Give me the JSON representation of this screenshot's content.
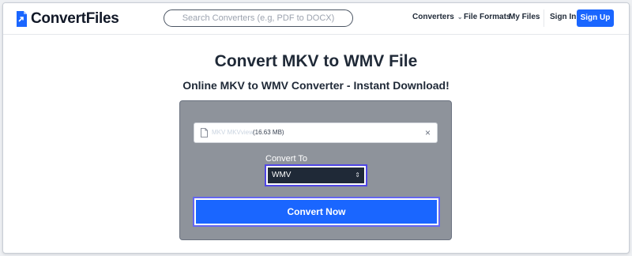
{
  "brand": {
    "name": "ConvertFiles",
    "color": "#1a66ff"
  },
  "nav": {
    "search_placeholder": "Search Converters (e.g, PDF to DOCX)",
    "converters": "Converters",
    "file_formats": "File Formats",
    "my_files": "My Files",
    "sign_in": "Sign In",
    "sign_up": "Sign Up"
  },
  "main": {
    "title": "Convert MKV to WMV File",
    "subtitle": "Online MKV to WMV Converter - Instant Download!"
  },
  "converter": {
    "file_name": "MKV MKVview",
    "file_size": "(16.63 MB)",
    "convert_to_label": "Convert To",
    "selected_format": "WMV",
    "convert_button": "Convert Now"
  },
  "icons": {
    "logo": "convertfiles-logo-icon",
    "file": "file-icon",
    "close": "close-icon",
    "chevron": "chevron-down-icon",
    "select_arrows": "updown-arrows-icon"
  }
}
